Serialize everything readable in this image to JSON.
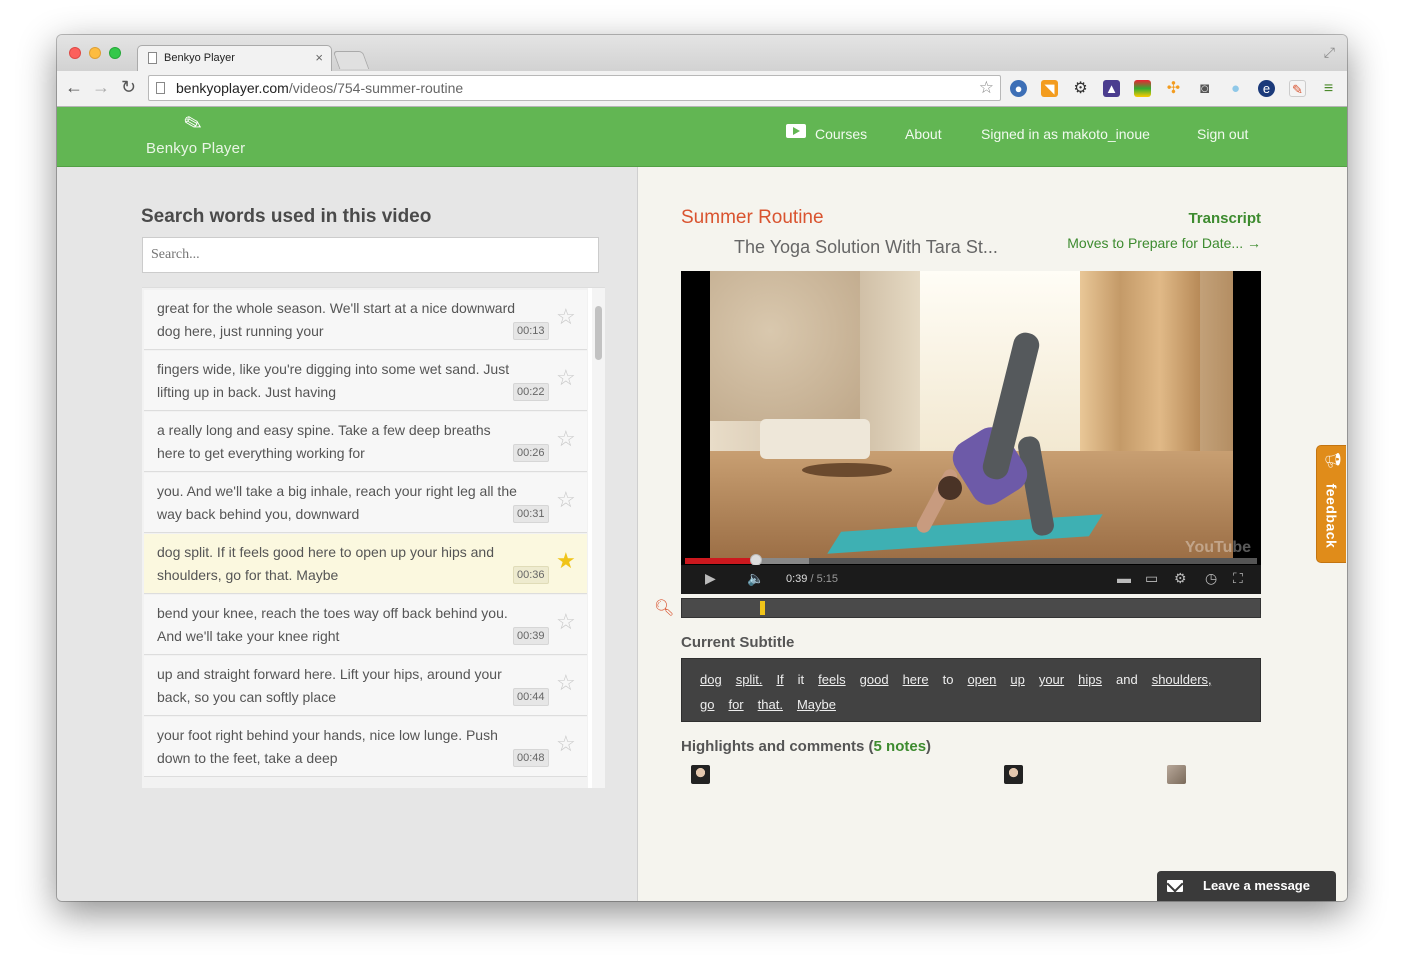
{
  "browser": {
    "tab_title": "Benkyo Player",
    "tab_close": "×",
    "url_domain": "benkyoplayer.com",
    "url_path": "/videos/754-summer-routine",
    "icons": [
      "back-icon",
      "forward-icon",
      "reload-icon",
      "bookmark-star-icon",
      "globe-extension-icon",
      "rss-extension-icon",
      "gear-extension-icon",
      "media-extension-icon",
      "chart-extension-icon",
      "cluster-extension-icon",
      "pocket-extension-icon",
      "drop-extension-icon",
      "ftp-extension-icon",
      "note-extension-icon",
      "menu-icon"
    ]
  },
  "site": {
    "logo_text": "Benkyo Player",
    "nav": {
      "courses": "Courses",
      "about": "About",
      "signed_in": "Signed in as makoto_inoue",
      "sign_out": "Sign out"
    },
    "accent_color": "#62b653"
  },
  "search": {
    "heading": "Search words used in this video",
    "placeholder": "Search..."
  },
  "captions": [
    {
      "text": "great for the whole season. We'll start at a nice downward dog here, just running your",
      "time": "00:13",
      "starred": false
    },
    {
      "text": "fingers wide, like you're digging into some wet sand. Just lifting up in back. Just having",
      "time": "00:22",
      "starred": false
    },
    {
      "text": "a really long and easy spine. Take a few deep breaths here to get everything working for",
      "time": "00:26",
      "starred": false
    },
    {
      "text": "you. And we'll take a big inhale, reach your right leg all the way back behind you, downward",
      "time": "00:31",
      "starred": false
    },
    {
      "text": "dog split. If it feels good here to open up your hips and shoulders, go for that. Maybe",
      "time": "00:36",
      "starred": true
    },
    {
      "text": "bend your knee, reach the toes way off back behind you. And we'll take your knee right",
      "time": "00:39",
      "starred": false
    },
    {
      "text": "up and straight forward here. Lift your hips, around your back, so you can softly place",
      "time": "00:44",
      "starred": false
    },
    {
      "text": "your foot right behind your hands, nice low lunge. Push down to the feet, take a deep",
      "time": "00:48",
      "starred": false
    }
  ],
  "video": {
    "title": "Summer Routine",
    "channel": "The Yoga Solution With Tara St...",
    "transcript_label": "Transcript",
    "next_label": "Moves to Prepare for Date... →",
    "current_time": "0:39",
    "duration": "/ 5:15",
    "progress_fraction": 0.124,
    "yt_logo": "YouTube"
  },
  "subtitle": {
    "label": "Current Subtitle",
    "words": [
      {
        "w": "dog",
        "link": true
      },
      {
        "w": "split.",
        "link": true
      },
      {
        "w": "If",
        "link": true
      },
      {
        "w": "it",
        "link": false
      },
      {
        "w": "feels",
        "link": true
      },
      {
        "w": "good",
        "link": true
      },
      {
        "w": "here",
        "link": true
      },
      {
        "w": "to",
        "link": false
      },
      {
        "w": "open",
        "link": true
      },
      {
        "w": "up",
        "link": true
      },
      {
        "w": "your",
        "link": true
      },
      {
        "w": "hips",
        "link": true
      },
      {
        "w": "and",
        "link": false
      },
      {
        "w": "shoulders,",
        "link": true
      },
      {
        "w": "go",
        "link": true
      },
      {
        "w": "for",
        "link": true
      },
      {
        "w": "that.",
        "link": true
      },
      {
        "w": "Maybe",
        "link": true
      }
    ]
  },
  "highlights": {
    "label": "Highlights and comments (",
    "count": "5 notes",
    "close": ")"
  },
  "feedback": {
    "label": "feedback"
  },
  "leave_message": {
    "label": "Leave a message"
  }
}
